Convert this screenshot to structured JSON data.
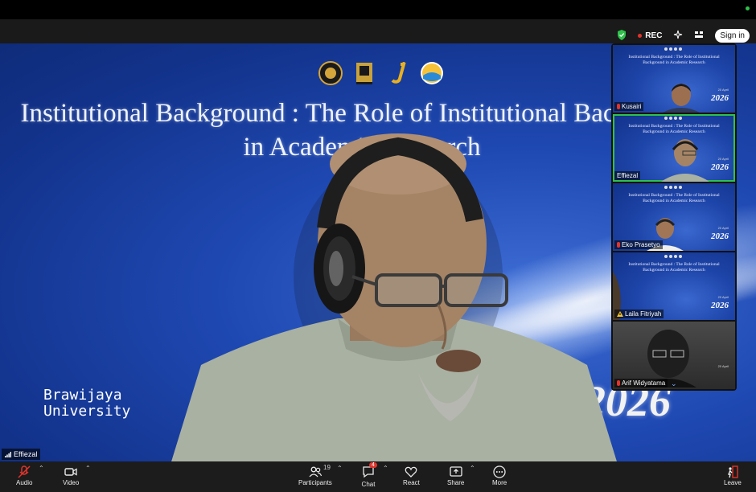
{
  "app": {
    "status_dot_color": "#2ec24a",
    "recording_label": "REC",
    "sign_in_label": "Sign in"
  },
  "slide": {
    "title": "Institutional Background : The Role of Institutional Background in Academic Research",
    "university": "Brawijaya University",
    "year": "2026"
  },
  "main_speaker": {
    "name": "Effiezal"
  },
  "gallery": {
    "tile_title": "Institutional Background : The Role of Institutional Background in Academic Research",
    "tile_date": "20 April",
    "tile_year": "2026",
    "participants": [
      {
        "name": "Kusairi",
        "muted": true,
        "active": false
      },
      {
        "name": "Effiezal",
        "muted": false,
        "active": true
      },
      {
        "name": "Eko Prasetyo",
        "muted": true,
        "active": false
      },
      {
        "name": "Laila Fitriyah",
        "muted": false,
        "warning": true,
        "active": false
      },
      {
        "name": "Arif Widyatama",
        "muted": true,
        "active": false
      }
    ]
  },
  "toolbar": {
    "audio": "Audio",
    "video": "Video",
    "participants": "Participants",
    "participants_count": "19",
    "chat": "Chat",
    "chat_badge": "4",
    "react": "React",
    "share": "Share",
    "more": "More",
    "leave": "Leave"
  }
}
